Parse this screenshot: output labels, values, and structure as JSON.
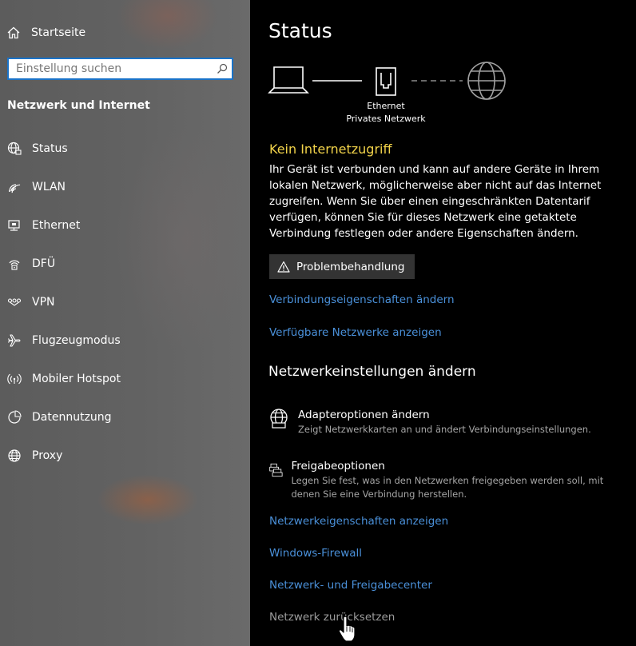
{
  "sidebar": {
    "home_label": "Startseite",
    "search_placeholder": "Einstellung suchen",
    "section_title": "Netzwerk und Internet",
    "items": [
      {
        "label": "Status",
        "icon": "globe-network-icon"
      },
      {
        "label": "WLAN",
        "icon": "wifi-icon"
      },
      {
        "label": "Ethernet",
        "icon": "ethernet-icon"
      },
      {
        "label": "DFÜ",
        "icon": "dialup-icon"
      },
      {
        "label": "VPN",
        "icon": "vpn-icon"
      },
      {
        "label": "Flugzeugmodus",
        "icon": "airplane-icon"
      },
      {
        "label": "Mobiler Hotspot",
        "icon": "hotspot-icon"
      },
      {
        "label": "Datennutzung",
        "icon": "data-usage-icon"
      },
      {
        "label": "Proxy",
        "icon": "globe-icon"
      }
    ]
  },
  "main": {
    "title": "Status",
    "diagram": {
      "adapter_name": "Ethernet",
      "network_name": "Privates Netzwerk",
      "icons": [
        "laptop-icon",
        "ethernet-port-icon",
        "globe-icon"
      ]
    },
    "status_heading": "Kein Internetzugriff",
    "status_color": "#f2d34a",
    "description": "Ihr Gerät ist verbunden und kann auf andere Geräte in Ihrem lokalen Netzwerk, möglicherweise aber nicht auf das Internet zugreifen. Wenn Sie über einen eingeschränkten Datentarif verfügen, können Sie für dieses Netzwerk eine getaktete Verbindung festlegen oder andere Eigenschaften ändern.",
    "troubleshoot_label": "Problembehandlung",
    "links_top": [
      "Verbindungseigenschaften ändern",
      "Verfügbare Netzwerke anzeigen"
    ],
    "settings_heading": "Netzwerkeinstellungen ändern",
    "options": [
      {
        "title": "Adapteroptionen ändern",
        "subtitle": "Zeigt Netzwerkkarten an und ändert Verbindungseinstellungen.",
        "icon": "adapter-globe-icon"
      },
      {
        "title": "Freigabeoptionen",
        "subtitle": "Legen Sie fest, was in den Netzwerken freigegeben werden soll, mit denen Sie eine Verbindung herstellen.",
        "icon": "sharing-icon"
      }
    ],
    "links_bottom": [
      "Netzwerkeigenschaften anzeigen",
      "Windows-Firewall",
      "Netzwerk- und Freigabecenter",
      "Netzwerk zurücksetzen"
    ],
    "link_color": "#4a90d9"
  }
}
